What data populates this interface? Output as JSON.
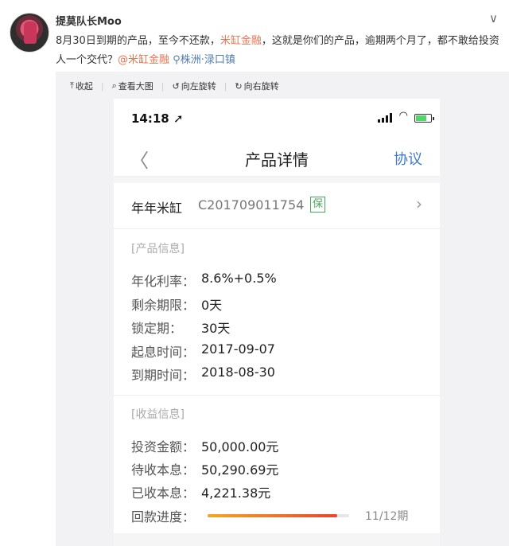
{
  "post": {
    "username": "提莫队长Moo",
    "text_part1": "8月30日到期的产品，至今不还款，",
    "text_link": "米缸金融",
    "text_part2": "，这就是你们的产品，逾期两个月了，都不敢给投资人一个交代？",
    "mention": "@米缸金融",
    "location": "株洲·渌口镇"
  },
  "toolbar": {
    "collapse": "收起",
    "view_large": "查看大图",
    "rotate_left": "向左旋转",
    "rotate_right": "向右旋转"
  },
  "phone": {
    "time": "14:18",
    "nav": {
      "back": "〈",
      "title": "产品详情",
      "right": "协议"
    },
    "product": {
      "name": "年年米缸",
      "code": "C201709011754",
      "badge": "保"
    },
    "product_info": {
      "section": "[产品信息]",
      "rows": [
        {
          "label": "年化利率：",
          "value": "8.6%+0.5%"
        },
        {
          "label": "剩余期限：",
          "value": "0天"
        },
        {
          "label": "锁定期：",
          "value": "30天"
        },
        {
          "label": "起息时间：",
          "value": "2017-09-07"
        },
        {
          "label": "到期时间：",
          "value": "2018-08-30"
        }
      ]
    },
    "income_info": {
      "section": "[收益信息]",
      "rows": [
        {
          "label": "投资金额：",
          "value": "50,000.00元"
        },
        {
          "label": "待收本息：",
          "value": "50,290.69元"
        },
        {
          "label": "已收本息：",
          "value": "4,221.38元"
        }
      ],
      "progress_label": "回款进度：",
      "progress_text": "11/12期",
      "progress_fraction": 0.917
    }
  }
}
